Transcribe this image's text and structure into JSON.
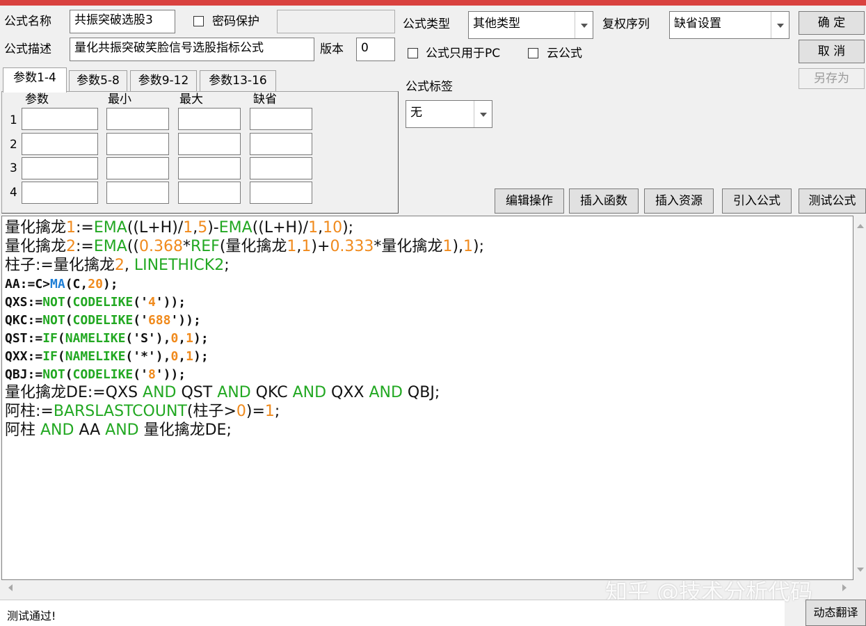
{
  "form": {
    "name_label": "公式名称",
    "name_value": "共振突破选股3",
    "password_label": "密码保护",
    "desc_label": "公式描述",
    "desc_value": "量化共振突破笑脸信号选股指标公式",
    "version_label": "版本",
    "version_value": "0",
    "type_label": "公式类型",
    "type_value": "其他类型",
    "rights_label": "复权序列",
    "rights_value": "缺省设置",
    "pc_only_label": "公式只用于PC",
    "cloud_label": "云公式",
    "tag_label": "公式标签",
    "tag_value": "无"
  },
  "buttons": {
    "ok": "确  定",
    "cancel": "取  消",
    "save_as": "另存为",
    "edit_ops": "编辑操作",
    "insert_func": "插入函数",
    "insert_res": "插入资源",
    "import_formula": "引入公式",
    "test_formula": "测试公式",
    "dynamic_translate": "动态翻译"
  },
  "params": {
    "tabs": [
      "参数1-4",
      "参数5-8",
      "参数9-12",
      "参数13-16"
    ],
    "headers": [
      "参数",
      "最小",
      "最大",
      "缺省"
    ],
    "rows": [
      "1",
      "2",
      "3",
      "4"
    ]
  },
  "code_lines": [
    "量化擒龙1:=EMA((L+H)/1,5)-EMA((L+H)/1,10);",
    "量化擒龙2:=EMA((0.368*REF(量化擒龙1,1)+0.333*量化擒龙1),1);",
    "柱子:=量化擒龙2, LINETHICK2;",
    "AA:=C>MA(C,20);",
    "QXS:=NOT(CODELIKE('4'));",
    "QKC:=NOT(CODELIKE('688'));",
    "QST:=IF(NAMELIKE('S'),0,1);",
    "QXX:=IF(NAMELIKE('*'),0,1);",
    "QBJ:=NOT(CODELIKE('8'));",
    "量化擒龙DE:=QXS AND QST AND QKC AND QXX AND QBJ;",
    "阿柱:=BARSLASTCOUNT(柱子>0)=1;",
    "阿柱 AND AA AND 量化擒龙DE;"
  ],
  "status": "测试通过!",
  "watermark": "知乎 @技术分析代码",
  "colors": {
    "titlebar": "#d9423f",
    "function": "#22a822",
    "number": "#f08a1c",
    "ma": "#1f7fd6"
  }
}
